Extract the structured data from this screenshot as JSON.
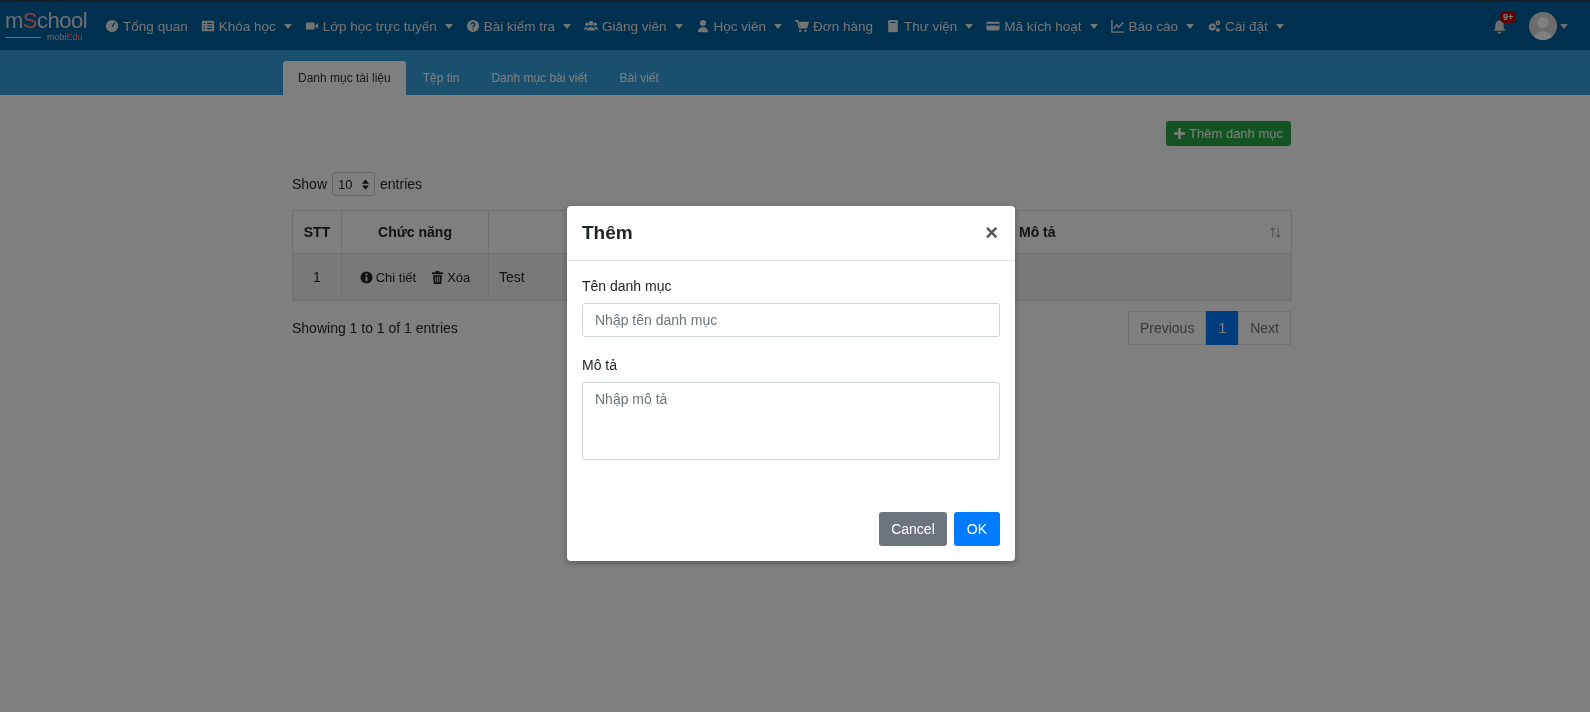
{
  "logo": {
    "lead": "m",
    "accent": "S",
    "tail": "chool",
    "sub_lead": "mobi",
    "sub_accent": "Edu"
  },
  "nav_items": [
    {
      "label": "Tổng quan",
      "dropdown": false
    },
    {
      "label": "Khóa học",
      "dropdown": true
    },
    {
      "label": "Lớp học trực tuyến",
      "dropdown": true
    },
    {
      "label": "Bài kiểm tra",
      "dropdown": true
    },
    {
      "label": "Giảng viên",
      "dropdown": true
    },
    {
      "label": "Học viên",
      "dropdown": true
    },
    {
      "label": "Đơn hàng",
      "dropdown": false
    },
    {
      "label": "Thư viện",
      "dropdown": true
    },
    {
      "label": "Mã kích hoạt",
      "dropdown": true
    },
    {
      "label": "Báo cáo",
      "dropdown": true
    },
    {
      "label": "Cài đặt",
      "dropdown": true
    }
  ],
  "notifications": {
    "badge": "9+"
  },
  "tabs": [
    {
      "label": "Danh mục tài liệu",
      "selected": true
    },
    {
      "label": "Tệp tin",
      "selected": false
    },
    {
      "label": "Danh mục bài viết",
      "selected": false
    },
    {
      "label": "Bài viết",
      "selected": false
    }
  ],
  "add_button": "Thêm danh mục",
  "length_menu": {
    "before": "Show",
    "value": "10",
    "after": "entries"
  },
  "table": {
    "columns": [
      {
        "kind": "text",
        "label": "STT",
        "sortable": false
      },
      {
        "kind": "text",
        "label": "Chức năng",
        "sortable": false
      },
      {
        "kind": "covered"
      },
      {
        "kind": "text",
        "label": "Mô tả",
        "sortable": true
      }
    ],
    "rows": [
      {
        "stt": "1",
        "actions": [
          {
            "kind": "info",
            "label": "Chi tiết"
          },
          {
            "kind": "delete",
            "label": "Xóa"
          }
        ],
        "name": "Test"
      }
    ]
  },
  "info": "Showing 1 to 1 of 1 entries",
  "pagination": [
    {
      "label": "Previous",
      "selected": false,
      "disabled": true
    },
    {
      "label": "1",
      "selected": true,
      "disabled": false
    },
    {
      "label": "Next",
      "selected": false,
      "disabled": true
    }
  ],
  "modal": {
    "title": "Thêm",
    "close": "×",
    "fields": [
      {
        "kind": "input",
        "label": "Tên danh mục",
        "placeholder": "Nhập tên danh mục"
      },
      {
        "kind": "textarea",
        "label": "Mô tả",
        "placeholder": "Nhập mô tả"
      }
    ],
    "buttons": [
      {
        "kind": "secondary",
        "label": "Cancel"
      },
      {
        "kind": "primary",
        "label": "OK"
      }
    ]
  }
}
